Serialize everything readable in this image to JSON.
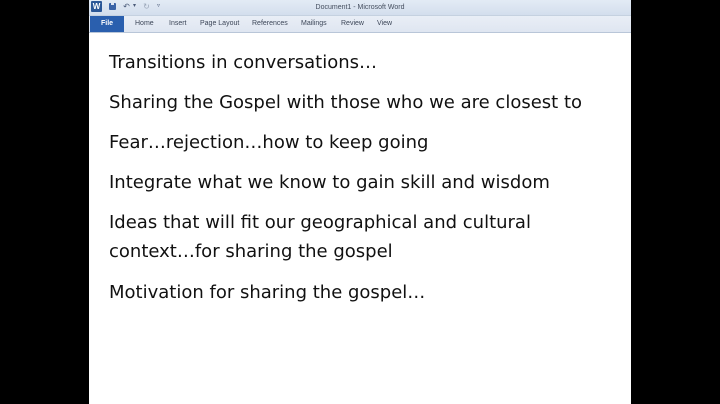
{
  "window": {
    "title": "Document1  -  Microsoft Word",
    "app_icon": "W",
    "quick_access": [
      "save-icon",
      "undo-icon",
      "redo-icon",
      "customize-menu-icon"
    ]
  },
  "ribbon": {
    "file_tab": "File",
    "tabs": [
      "Home",
      "Insert",
      "Page Layout",
      "References",
      "Mailings",
      "Review",
      "View"
    ]
  },
  "document": {
    "paragraphs": [
      [
        "Transitions in conversations…"
      ],
      [
        "Sharing the Gospel with those who we are closest to"
      ],
      [
        "Fear…rejection…how to keep going"
      ],
      [
        "Integrate what we know to gain skill and wisdom"
      ],
      [
        "Ideas that will fit our geographical and cultural",
        "context…for sharing the gospel"
      ],
      [
        "Motivation for sharing the gospel…"
      ]
    ]
  },
  "colors": {
    "file_tab": "#2a5fae",
    "ribbon_bg": "#e4eaf4",
    "page_bg": "#ffffff",
    "outer_bg": "#000000"
  }
}
